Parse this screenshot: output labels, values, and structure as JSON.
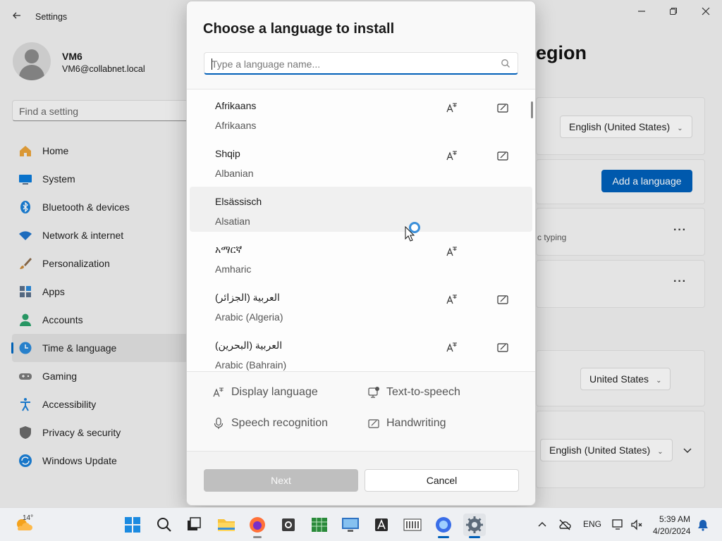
{
  "window": {
    "title": "Settings",
    "controls": {
      "minimize": "—",
      "maximize": "▢",
      "close": "✕"
    }
  },
  "user": {
    "name": "VM6",
    "email": "VM6@collabnet.local"
  },
  "search_setting": {
    "placeholder": "Find a setting"
  },
  "nav": {
    "items": [
      {
        "label": "Home",
        "icon": "home-icon",
        "color": "#e8a23a"
      },
      {
        "label": "System",
        "icon": "system-icon",
        "color": "#0a7ad8"
      },
      {
        "label": "Bluetooth & devices",
        "icon": "bluetooth-icon",
        "color": "#1a7fd6"
      },
      {
        "label": "Network & internet",
        "icon": "wifi-icon",
        "color": "#1f73c9"
      },
      {
        "label": "Personalization",
        "icon": "brush-icon",
        "color": "#c98a3a"
      },
      {
        "label": "Apps",
        "icon": "apps-icon",
        "color": "#5a6f8a"
      },
      {
        "label": "Accounts",
        "icon": "accounts-icon",
        "color": "#2aa06a"
      },
      {
        "label": "Time & language",
        "icon": "clock-globe-icon",
        "color": "#2a88d8",
        "active": true
      },
      {
        "label": "Gaming",
        "icon": "gamepad-icon",
        "color": "#7a7a7a"
      },
      {
        "label": "Accessibility",
        "icon": "accessibility-icon",
        "color": "#1a7fd6"
      },
      {
        "label": "Privacy & security",
        "icon": "shield-icon",
        "color": "#6a6a6a"
      },
      {
        "label": "Windows Update",
        "icon": "update-icon",
        "color": "#1a7fd6"
      }
    ]
  },
  "content": {
    "title_fragment": "egion",
    "windows_display_language": "English (United States)",
    "add_language_label": "Add a language",
    "typing_fragment": "c typing",
    "country": "United States",
    "regional_format": "English (United States)"
  },
  "dialog": {
    "title": "Choose a language to install",
    "search_placeholder": "Type a language name...",
    "languages": [
      {
        "native": "Afrikaans",
        "english": "Afrikaans",
        "display": true,
        "handwriting": true
      },
      {
        "native": "Shqip",
        "english": "Albanian",
        "display": true,
        "handwriting": true
      },
      {
        "native": "Elsässisch",
        "english": "Alsatian",
        "display": false,
        "handwriting": false,
        "hover": true
      },
      {
        "native": "አማርኛ",
        "english": "Amharic",
        "display": true,
        "handwriting": false
      },
      {
        "native": "(العربية (الجزائر",
        "english": "Arabic (Algeria)",
        "display": true,
        "handwriting": true
      },
      {
        "native": "(العربية (البحرين",
        "english": "Arabic (Bahrain)",
        "display": true,
        "handwriting": true
      }
    ],
    "legend": {
      "display_language": "Display language",
      "text_to_speech": "Text-to-speech",
      "speech_recognition": "Speech recognition",
      "handwriting": "Handwriting"
    },
    "next_label": "Next",
    "cancel_label": "Cancel"
  },
  "taskbar": {
    "weather_temp": "14°",
    "apps": [
      "start-icon",
      "search-icon",
      "task-view-icon",
      "file-explorer-icon",
      "firefox-icon",
      "outlook-icon",
      "spreadsheet-icon",
      "remote-desktop-icon",
      "font-app-icon",
      "equalizer-icon",
      "firefox-dev-icon",
      "settings-icon"
    ],
    "lang": "ENG",
    "time": "5:39 AM",
    "date": "4/20/2024"
  }
}
